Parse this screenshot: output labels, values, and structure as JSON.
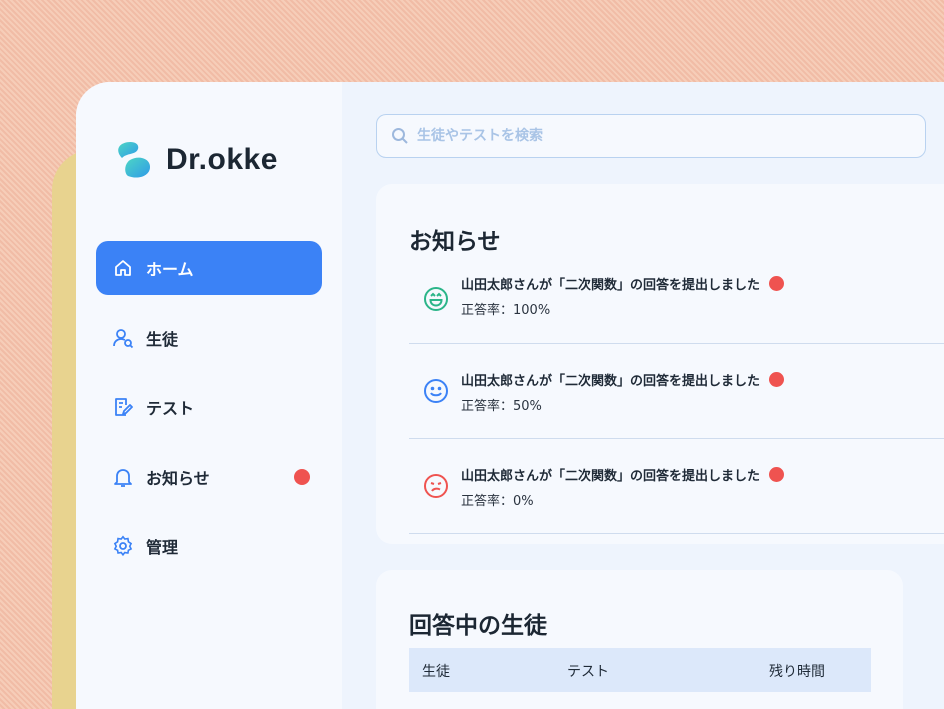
{
  "brand": {
    "name": "Dr.okke"
  },
  "sidebar": {
    "items": [
      {
        "label": "ホーム",
        "icon": "home-icon",
        "active": true
      },
      {
        "label": "生徒",
        "icon": "student-icon",
        "active": false
      },
      {
        "label": "テスト",
        "icon": "test-icon",
        "active": false
      },
      {
        "label": "お知らせ",
        "icon": "bell-icon",
        "active": false,
        "badge": true
      },
      {
        "label": "管理",
        "icon": "gear-icon",
        "active": false
      }
    ]
  },
  "search": {
    "placeholder": "生徒やテストを検索",
    "value": ""
  },
  "notices": {
    "title": "お知らせ",
    "items": [
      {
        "text": "山田太郎さんが「二次関数」の回答を提出しました",
        "sub": "正答率：100%",
        "face": "laughing-face-icon",
        "color": "#2bb589"
      },
      {
        "text": "山田太郎さんが「二次関数」の回答を提出しました",
        "sub": "正答率：50%",
        "face": "smiling-face-icon",
        "color": "#3b82f6"
      },
      {
        "text": "山田太郎さんが「二次関数」の回答を提出しました",
        "sub": "正答率：0%",
        "face": "sad-face-icon",
        "color": "#ef5350"
      }
    ]
  },
  "answering": {
    "title": "回答中の生徒",
    "columns": [
      "生徒",
      "テスト",
      "残り時間"
    ]
  },
  "colors": {
    "accent": "#3b82f6",
    "alert": "#ef5350",
    "success": "#2bb589"
  }
}
